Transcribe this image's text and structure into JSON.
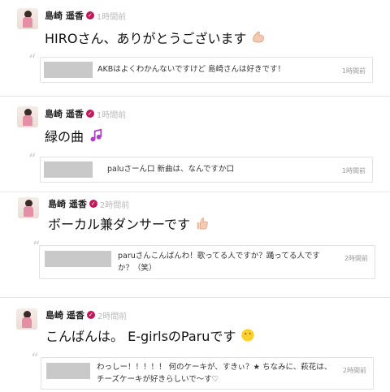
{
  "posts": [
    {
      "author": "島崎 遥香",
      "time": "1時間前",
      "text": "HIROさん、ありがとうございます",
      "emoji": "flexed-biceps-icon",
      "reply": {
        "text": "AKBはよくわかんないですけど 島崎さんは好きです！",
        "time": "1時間前"
      }
    },
    {
      "author": "島崎 遥香",
      "time": "1時間前",
      "text": "緑の曲",
      "emoji": "music-notes-icon",
      "reply": {
        "text": "paluさーん口 新曲は、なんですか口",
        "time": "1時間前"
      }
    },
    {
      "author": "島崎 遥香",
      "time": "2時間前",
      "text": "ボーカル兼ダンサーです",
      "emoji": "thumbs-up-icon",
      "reply": {
        "text": "paruさんこんばんわ！歌ってる人ですか？踊ってる人ですか？（笑）",
        "time": "2時間前"
      }
    },
    {
      "author": "島崎 遥香",
      "time": "2時間前",
      "text": "こんばんは。 E-girlsのParuです",
      "emoji": "smiley-face-icon",
      "reply": {
        "text": "わっしー！！！！！ 何のケーキが、すきぃ？★ ちなみに、萩花は、 チーズケーキが好きらしいで～す♡",
        "time": "2時間前"
      }
    }
  ],
  "colors": {
    "verified": "#c2185b",
    "accent_pink": "#e58fa6"
  }
}
